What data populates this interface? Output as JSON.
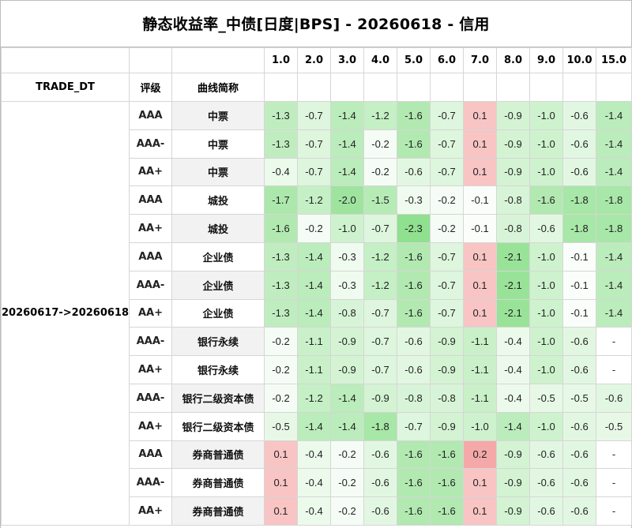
{
  "title": "静态收益率_中债[日度|BPS] - 20260618 - 信用",
  "header": {
    "trade_dt": "TRADE_DT",
    "rating": "评级",
    "curve": "曲线简称",
    "tenors": [
      "1.0",
      "2.0",
      "3.0",
      "4.0",
      "5.0",
      "6.0",
      "7.0",
      "8.0",
      "9.0",
      "10.0",
      "15.0"
    ]
  },
  "date_range": "20260617->20260618",
  "colors": {
    "green_max": "#8fe08f",
    "red_max": "#f4a7a7",
    "neutral": "#ffffff"
  },
  "rows": [
    {
      "rating": "AAA",
      "curve": "中票",
      "values": [
        "-1.3",
        "-0.7",
        "-1.4",
        "-1.2",
        "-1.6",
        "-0.7",
        "0.1",
        "-0.9",
        "-1.0",
        "-0.6",
        "-1.4"
      ]
    },
    {
      "rating": "AAA-",
      "curve": "中票",
      "values": [
        "-1.3",
        "-0.7",
        "-1.4",
        "-0.2",
        "-1.6",
        "-0.7",
        "0.1",
        "-0.9",
        "-1.0",
        "-0.6",
        "-1.4"
      ]
    },
    {
      "rating": "AA+",
      "curve": "中票",
      "values": [
        "-0.4",
        "-0.7",
        "-1.4",
        "-0.2",
        "-0.6",
        "-0.7",
        "0.1",
        "-0.9",
        "-1.0",
        "-0.6",
        "-1.4"
      ]
    },
    {
      "rating": "AAA",
      "curve": "城投",
      "values": [
        "-1.7",
        "-1.2",
        "-2.0",
        "-1.5",
        "-0.3",
        "-0.2",
        "-0.1",
        "-0.8",
        "-1.6",
        "-1.8",
        "-1.8"
      ]
    },
    {
      "rating": "AA+",
      "curve": "城投",
      "values": [
        "-1.6",
        "-0.2",
        "-1.0",
        "-0.7",
        "-2.3",
        "-0.2",
        "-0.1",
        "-0.8",
        "-0.6",
        "-1.8",
        "-1.8"
      ]
    },
    {
      "rating": "AAA",
      "curve": "企业债",
      "values": [
        "-1.3",
        "-1.4",
        "-0.3",
        "-1.2",
        "-1.6",
        "-0.7",
        "0.1",
        "-2.1",
        "-1.0",
        "-0.1",
        "-1.4"
      ]
    },
    {
      "rating": "AAA-",
      "curve": "企业债",
      "values": [
        "-1.3",
        "-1.4",
        "-0.3",
        "-1.2",
        "-1.6",
        "-0.7",
        "0.1",
        "-2.1",
        "-1.0",
        "-0.1",
        "-1.4"
      ]
    },
    {
      "rating": "AA+",
      "curve": "企业债",
      "values": [
        "-1.3",
        "-1.4",
        "-0.8",
        "-0.7",
        "-1.6",
        "-0.7",
        "0.1",
        "-2.1",
        "-1.0",
        "-0.1",
        "-1.4"
      ]
    },
    {
      "rating": "AAA-",
      "curve": "银行永续",
      "values": [
        "-0.2",
        "-1.1",
        "-0.9",
        "-0.7",
        "-0.6",
        "-0.9",
        "-1.1",
        "-0.4",
        "-1.0",
        "-0.6",
        "-"
      ]
    },
    {
      "rating": "AA+",
      "curve": "银行永续",
      "values": [
        "-0.2",
        "-1.1",
        "-0.9",
        "-0.7",
        "-0.6",
        "-0.9",
        "-1.1",
        "-0.4",
        "-1.0",
        "-0.6",
        "-"
      ]
    },
    {
      "rating": "AAA-",
      "curve": "银行二级资本债",
      "values": [
        "-0.2",
        "-1.2",
        "-1.4",
        "-0.9",
        "-0.8",
        "-0.8",
        "-1.1",
        "-0.4",
        "-0.5",
        "-0.5",
        "-0.6"
      ]
    },
    {
      "rating": "AA+",
      "curve": "银行二级资本债",
      "values": [
        "-0.5",
        "-1.4",
        "-1.4",
        "-1.8",
        "-0.7",
        "-0.9",
        "-1.0",
        "-1.4",
        "-1.0",
        "-0.6",
        "-0.5"
      ]
    },
    {
      "rating": "AAA",
      "curve": "券商普通债",
      "values": [
        "0.1",
        "-0.4",
        "-0.2",
        "-0.6",
        "-1.6",
        "-1.6",
        "0.2",
        "-0.9",
        "-0.6",
        "-0.6",
        "-"
      ]
    },
    {
      "rating": "AAA-",
      "curve": "券商普通债",
      "values": [
        "0.1",
        "-0.4",
        "-0.2",
        "-0.6",
        "-1.6",
        "-1.6",
        "0.1",
        "-0.9",
        "-0.6",
        "-0.6",
        "-"
      ]
    },
    {
      "rating": "AA+",
      "curve": "券商普通债",
      "values": [
        "0.1",
        "-0.4",
        "-0.2",
        "-0.6",
        "-1.6",
        "-1.6",
        "0.1",
        "-0.9",
        "-0.6",
        "-0.6",
        "-"
      ]
    }
  ]
}
